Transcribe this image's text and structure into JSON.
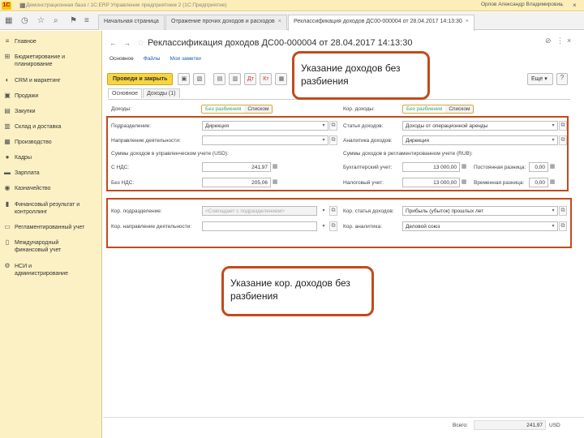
{
  "window": {
    "title": "Демонстрационная база / 1С:ERP Управление предприятием 2  (1С:Предприятие)",
    "user": "Орлов Александр Владимирович"
  },
  "tabs": [
    {
      "label": "Начальная страница"
    },
    {
      "label": "Отражение прочих доходов и расходов"
    },
    {
      "label": "Реклассификация доходов ДС00-000004 от 28.04.2017 14:13:30"
    }
  ],
  "sidebar": {
    "items": [
      {
        "label": "Главное",
        "icon": "menu-icon"
      },
      {
        "label": "Бюджетирование и\nпланирование",
        "icon": "budget-icon"
      },
      {
        "label": "CRM и маркетинг",
        "icon": "crm-icon"
      },
      {
        "label": "Продажи",
        "icon": "sales-icon"
      },
      {
        "label": "Закупки",
        "icon": "purchases-icon"
      },
      {
        "label": "Склад и доставка",
        "icon": "warehouse-icon"
      },
      {
        "label": "Производство",
        "icon": "production-icon"
      },
      {
        "label": "Кадры",
        "icon": "hr-icon"
      },
      {
        "label": "Зарплата",
        "icon": "salary-icon"
      },
      {
        "label": "Казначейство",
        "icon": "treasury-icon"
      },
      {
        "label": "Финансовый результат и\nконтроллинг",
        "icon": "finance-icon"
      },
      {
        "label": "Регламентированный учет",
        "icon": "accounting-icon"
      },
      {
        "label": "Международный\nфинансовый учет",
        "icon": "international-icon"
      },
      {
        "label": "НСИ и\nадминистрирование",
        "icon": "admin-icon"
      }
    ]
  },
  "form": {
    "title": "Реклассификация доходов ДС00-000004 от 28.04.2017 14:13:30",
    "subnav": {
      "main": "Основное",
      "files": "Файлы",
      "notes": "Мои заметки"
    },
    "toolbar": {
      "post_close": "Проведи и закрыть",
      "more": "Еще",
      "help": "?"
    },
    "tabs": {
      "main": "Основное",
      "income": "Доходы (1)"
    },
    "income": {
      "label": "Доходы:",
      "mode_nosplit": "Без разбиения",
      "mode_list": "Списком",
      "division_label": "Подразделение:",
      "division_value": "Дирекция",
      "direction_label": "Направление деятельности:",
      "direction_value": "",
      "mgmt_sums_label": "Суммы доходов в управленческом учете (USD):",
      "with_vat_label": "С НДС:",
      "with_vat_value": "241,97",
      "without_vat_label": "Без НДС:",
      "without_vat_value": "205,06"
    },
    "cor_income": {
      "label": "Кор. доходы:",
      "mode_nosplit": "Без разбиения",
      "mode_list": "Списком",
      "item_label": "Статья доходов:",
      "item_value": "Доходы от операционной аренды",
      "analytics_label": "Аналитика доходов:",
      "analytics_value": "Дирекция",
      "reg_sums_label": "Суммы доходов в регламентированном учете (RUB):",
      "acc_label": "Бухгалтерский учет:",
      "acc_value": "13 000,00",
      "perm_label": "Постоянная разница:",
      "perm_value": "0,00",
      "tax_label": "Налоговый учет:",
      "tax_value": "13 000,00",
      "temp_label": "Временная разница:",
      "temp_value": "0,00"
    },
    "cor_section": {
      "division_label": "Кор. подразделение:",
      "division_placeholder": "<Совпадает с подразделением>",
      "direction_label": "Кор. направление деятельности:",
      "direction_value": "",
      "item_label": "Кор. статья доходов:",
      "item_value": "Прибыль (убыток) прошлых лет",
      "analytics_label": "Кор. аналитика:",
      "analytics_value": "Деловой союз"
    },
    "footer": {
      "total_label": "Всего:",
      "total_value": "241,97",
      "currency": "USD"
    }
  },
  "callouts": {
    "top": "Указание доходов без разбиения",
    "bottom": "Указание кор. доходов без разбиения"
  },
  "colors": {
    "accent": "#c34a1b",
    "primary_button": "#f8d43f",
    "sidebar_bg": "#fbf1c4"
  }
}
